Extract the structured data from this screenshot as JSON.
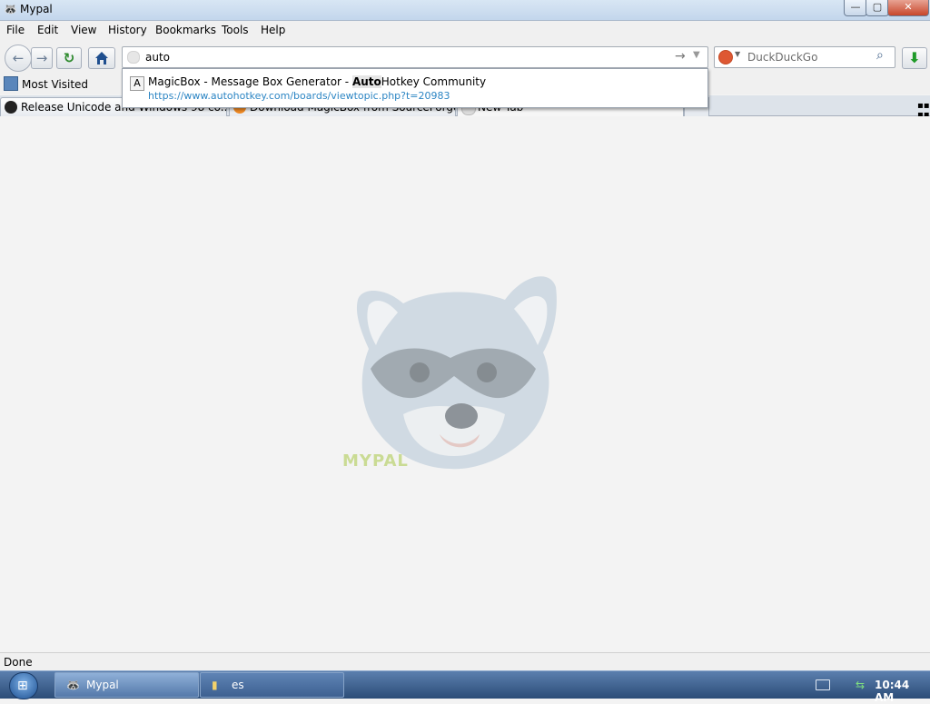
{
  "window": {
    "title": "Mypal",
    "buttons": {
      "minimize": "—",
      "maximize": "▢",
      "close": "✕"
    }
  },
  "menu": {
    "items": [
      "File",
      "Edit",
      "View",
      "History",
      "Bookmarks",
      "Tools",
      "Help"
    ]
  },
  "nav": {
    "back_icon": "back-arrow-icon",
    "forward_icon": "forward-arrow-icon",
    "reload_icon": "reload-icon",
    "home_icon": "home-icon",
    "url_value": "auto",
    "search_placeholder": "DuckDuckGo",
    "download_icon": "download-arrow-icon"
  },
  "bookmarks": {
    "most_visited": "Most Visited"
  },
  "tabs": [
    {
      "label": "Release Unicode and Windows 98 co..."
    },
    {
      "label": "Download MagicBox from SourceForge..."
    },
    {
      "label": "New Tab"
    }
  ],
  "autocomplete": {
    "icon_letter": "A",
    "title_before": "MagicBox - Message Box Generator - ",
    "title_match": "Auto",
    "title_after": "Hotkey Community",
    "url": "https://www.autohotkey.com/boards/viewtopic.php?t=20983"
  },
  "content": {
    "brand_text": "MYPAL"
  },
  "status": {
    "text": "Done"
  },
  "taskbar": {
    "tasks": [
      {
        "label": "Mypal",
        "active": true
      },
      {
        "label": "es",
        "active": false
      }
    ],
    "clock": "10:44 AM"
  },
  "colors": {
    "titlebar": "#c3d6ec",
    "taskbar": "#2c4d78",
    "link": "#2d86c4",
    "close_button": "#c7462b",
    "download_green": "#1e9a28"
  }
}
